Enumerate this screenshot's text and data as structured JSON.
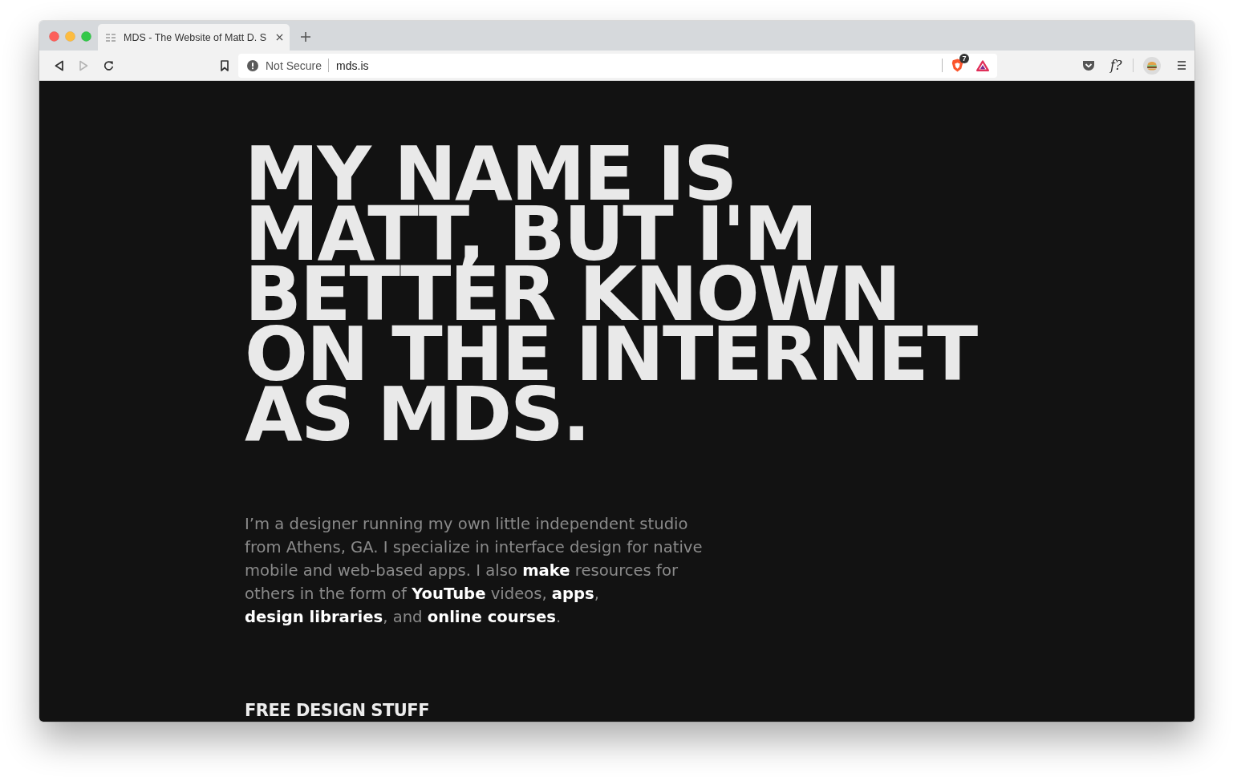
{
  "window": {
    "controls": [
      {
        "kind": "close"
      },
      {
        "kind": "minimize"
      },
      {
        "kind": "zoom"
      }
    ]
  },
  "tabs": [
    {
      "title": "MDS - The Website of Matt D. S",
      "selected": true
    }
  ],
  "toolbar": {
    "nav_buttons": [
      {
        "kind": "back",
        "disabled": false
      },
      {
        "kind": "forward",
        "disabled": true
      },
      {
        "kind": "reload",
        "disabled": false
      }
    ],
    "address_bar": {
      "security": "Not Secure",
      "url": "mds.is",
      "extensions": [
        {
          "kind": "shield",
          "badge": "7"
        },
        {
          "kind": "triangle"
        }
      ]
    },
    "items": [
      {
        "kind": "pocket"
      },
      {
        "kind": "text",
        "label": "f?"
      },
      {
        "kind": "avatar"
      },
      {
        "kind": "menu"
      }
    ]
  },
  "page": {
    "headline": "MY NAME IS MATT, BUT I'M BETTER KNOWN ON THE INTERNET AS MDS.",
    "intro": [
      {
        "kind": "text",
        "text": "I’m a designer running my own little independent studio from Athens, GA. I specialize in interface design for native mobile and web-based apps. I also "
      },
      {
        "kind": "link",
        "text": "make"
      },
      {
        "kind": "text",
        "text": " resources for others in the form of "
      },
      {
        "kind": "link",
        "text": "YouTube"
      },
      {
        "kind": "text",
        "text": " videos, "
      },
      {
        "kind": "link",
        "text": "apps"
      },
      {
        "kind": "text",
        "text": ", "
      },
      {
        "kind": "link",
        "text": "design libraries"
      },
      {
        "kind": "text",
        "text": ", and "
      },
      {
        "kind": "link",
        "text": "online courses"
      },
      {
        "kind": "text",
        "text": "."
      }
    ],
    "section_heading": "FREE DESIGN STUFF"
  }
}
